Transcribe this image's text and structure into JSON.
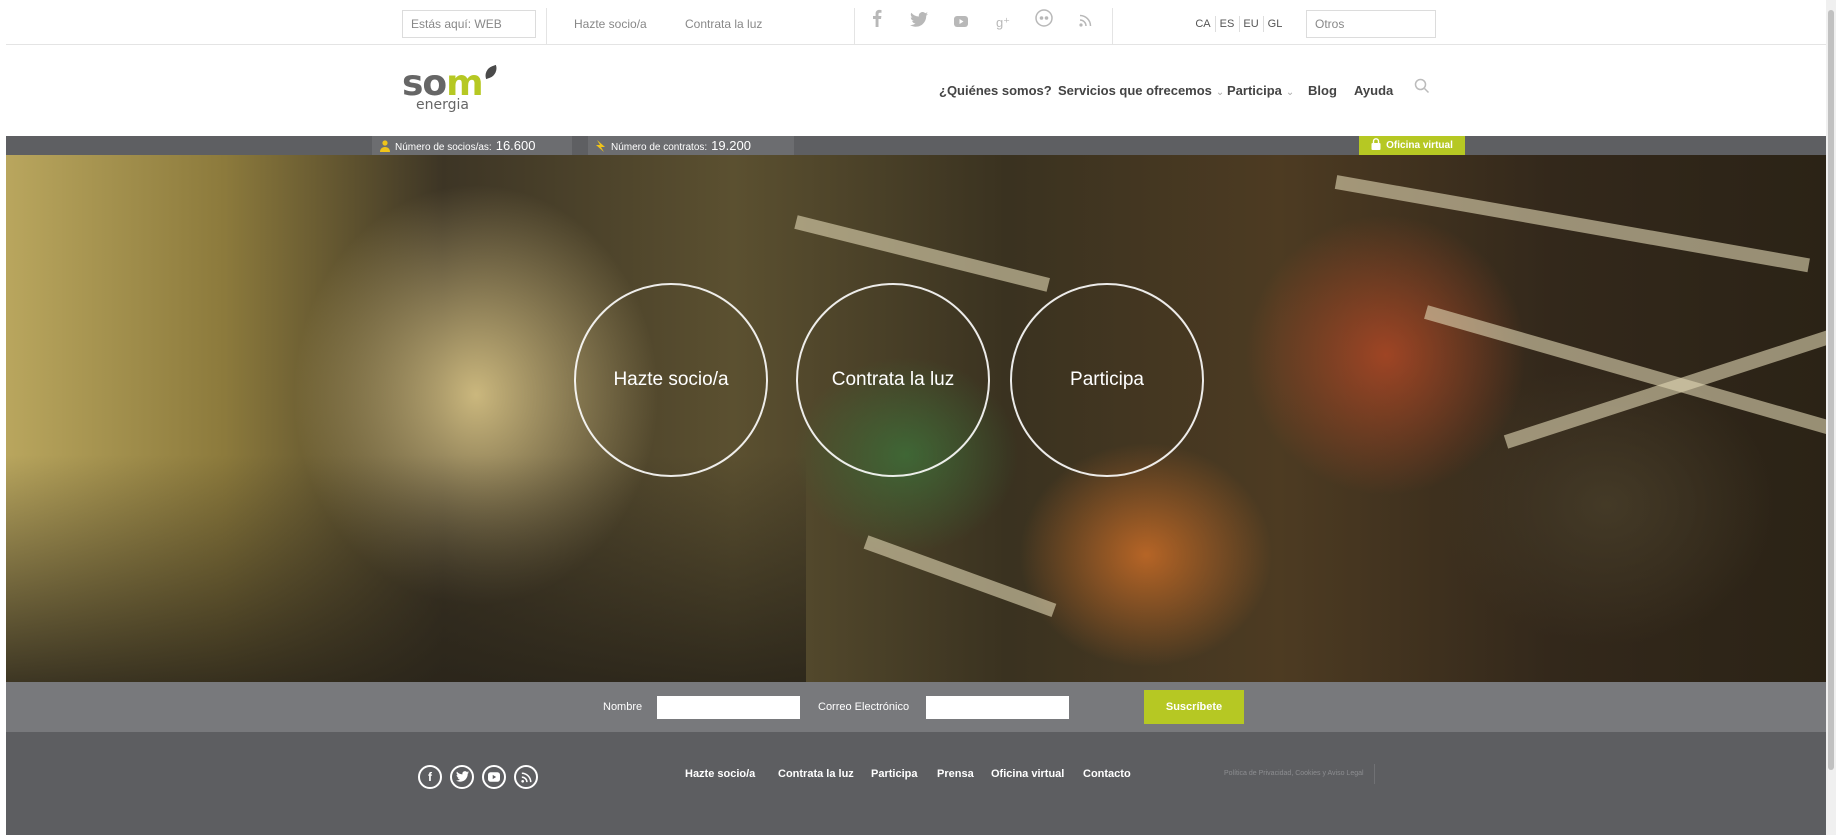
{
  "topbar": {
    "breadcrumb": "Estás aquí: WEB",
    "links": [
      "Hazte socio/a",
      "Contrata la luz"
    ],
    "social_icons": [
      "facebook-icon",
      "twitter-icon",
      "youtube-icon",
      "googleplus-icon",
      "flickr-icon",
      "rss-icon"
    ],
    "languages": [
      "CA",
      "ES",
      "EU",
      "GL"
    ],
    "otros_placeholder": "Otros"
  },
  "header": {
    "logo": {
      "word": "som",
      "sub": "energia"
    },
    "nav": [
      {
        "label": "¿Quiénes somos?",
        "dropdown": false
      },
      {
        "label": "Servicios que ofrecemos",
        "dropdown": true
      },
      {
        "label": "Participa",
        "dropdown": true
      },
      {
        "label": "Blog",
        "dropdown": false
      },
      {
        "label": "Ayuda",
        "dropdown": false
      }
    ]
  },
  "stats": {
    "socios_label": "Número de socios/as:",
    "socios_value": "16.600",
    "contratos_label": "Número de contratos:",
    "contratos_value": "19.200",
    "oficina": "Oficina virtual"
  },
  "hero": {
    "buttons": [
      "Hazte socio/a",
      "Contrata la luz",
      "Participa"
    ]
  },
  "subscribe": {
    "nombre_label": "Nombre",
    "email_label": "Correo Electrónico",
    "button": "Suscríbete"
  },
  "footer": {
    "social_icons": [
      "facebook-icon",
      "twitter-icon",
      "youtube-icon",
      "rss-icon"
    ],
    "links": [
      "Hazte socio/a",
      "Contrata la luz",
      "Participa",
      "Prensa",
      "Oficina virtual",
      "Contacto"
    ],
    "legal": "Política de Privacidad, Cookies y Aviso Legal"
  },
  "colors": {
    "accent": "#b6c823",
    "stats_bar": "#5e5f62",
    "subscribe_bar": "#78797c",
    "footer": "#5d5e61"
  }
}
